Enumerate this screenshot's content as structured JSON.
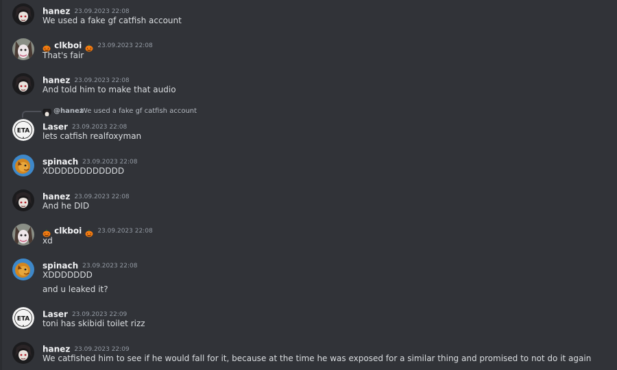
{
  "colors": {
    "background": "#313338",
    "username": "#f2f3f5",
    "message_text": "#dbdee1",
    "timestamp": "#949ba4"
  },
  "messages": [
    {
      "author": "hanez",
      "timestamp": "23.09.2023 22:08",
      "lines": [
        "We used a fake gf catfish account"
      ],
      "avatar": "hanez-avatar"
    },
    {
      "author": "clkboi",
      "timestamp": "23.09.2023 22:08",
      "lines": [
        "That's fair"
      ],
      "avatar": "clkboi-avatar",
      "badges": [
        "pumpkin-emoji",
        "pumpkin-emoji"
      ]
    },
    {
      "author": "hanez",
      "timestamp": "23.09.2023 22:08",
      "lines": [
        "And told him to make that audio"
      ],
      "avatar": "hanez-avatar"
    },
    {
      "author": "Laser",
      "timestamp": "23.09.2023 22:08",
      "lines": [
        "lets catfish realfoxyman"
      ],
      "avatar": "laser-eta-avatar",
      "reply": {
        "mention": "@hanez",
        "text": "We used a fake gf catfish account"
      }
    },
    {
      "author": "spinach",
      "timestamp": "23.09.2023 22:08",
      "lines": [
        "XDDDDDDDDDDDD"
      ],
      "avatar": "spinach-avatar"
    },
    {
      "author": "hanez",
      "timestamp": "23.09.2023 22:08",
      "lines": [
        "And he DID"
      ],
      "avatar": "hanez-avatar"
    },
    {
      "author": "clkboi",
      "timestamp": "23.09.2023 22:08",
      "lines": [
        "xd"
      ],
      "avatar": "clkboi-avatar",
      "badges": [
        "pumpkin-emoji",
        "pumpkin-emoji"
      ]
    },
    {
      "author": "spinach",
      "timestamp": "23.09.2023 22:08",
      "lines": [
        "XDDDDDDD",
        "and u leaked it?"
      ],
      "avatar": "spinach-avatar"
    },
    {
      "author": "Laser",
      "timestamp": "23.09.2023 22:09",
      "lines": [
        "toni has skibidi toilet rizz"
      ],
      "avatar": "laser-eta-avatar"
    },
    {
      "author": "hanez",
      "timestamp": "23.09.2023 22:09",
      "lines": [
        "We catfished him to see if he would fall for it, because at the time he was exposed for a similar thing and promised to not do it again"
      ],
      "avatar": "hanez-avatar"
    }
  ],
  "avatar_text": {
    "eta": "ETA"
  }
}
